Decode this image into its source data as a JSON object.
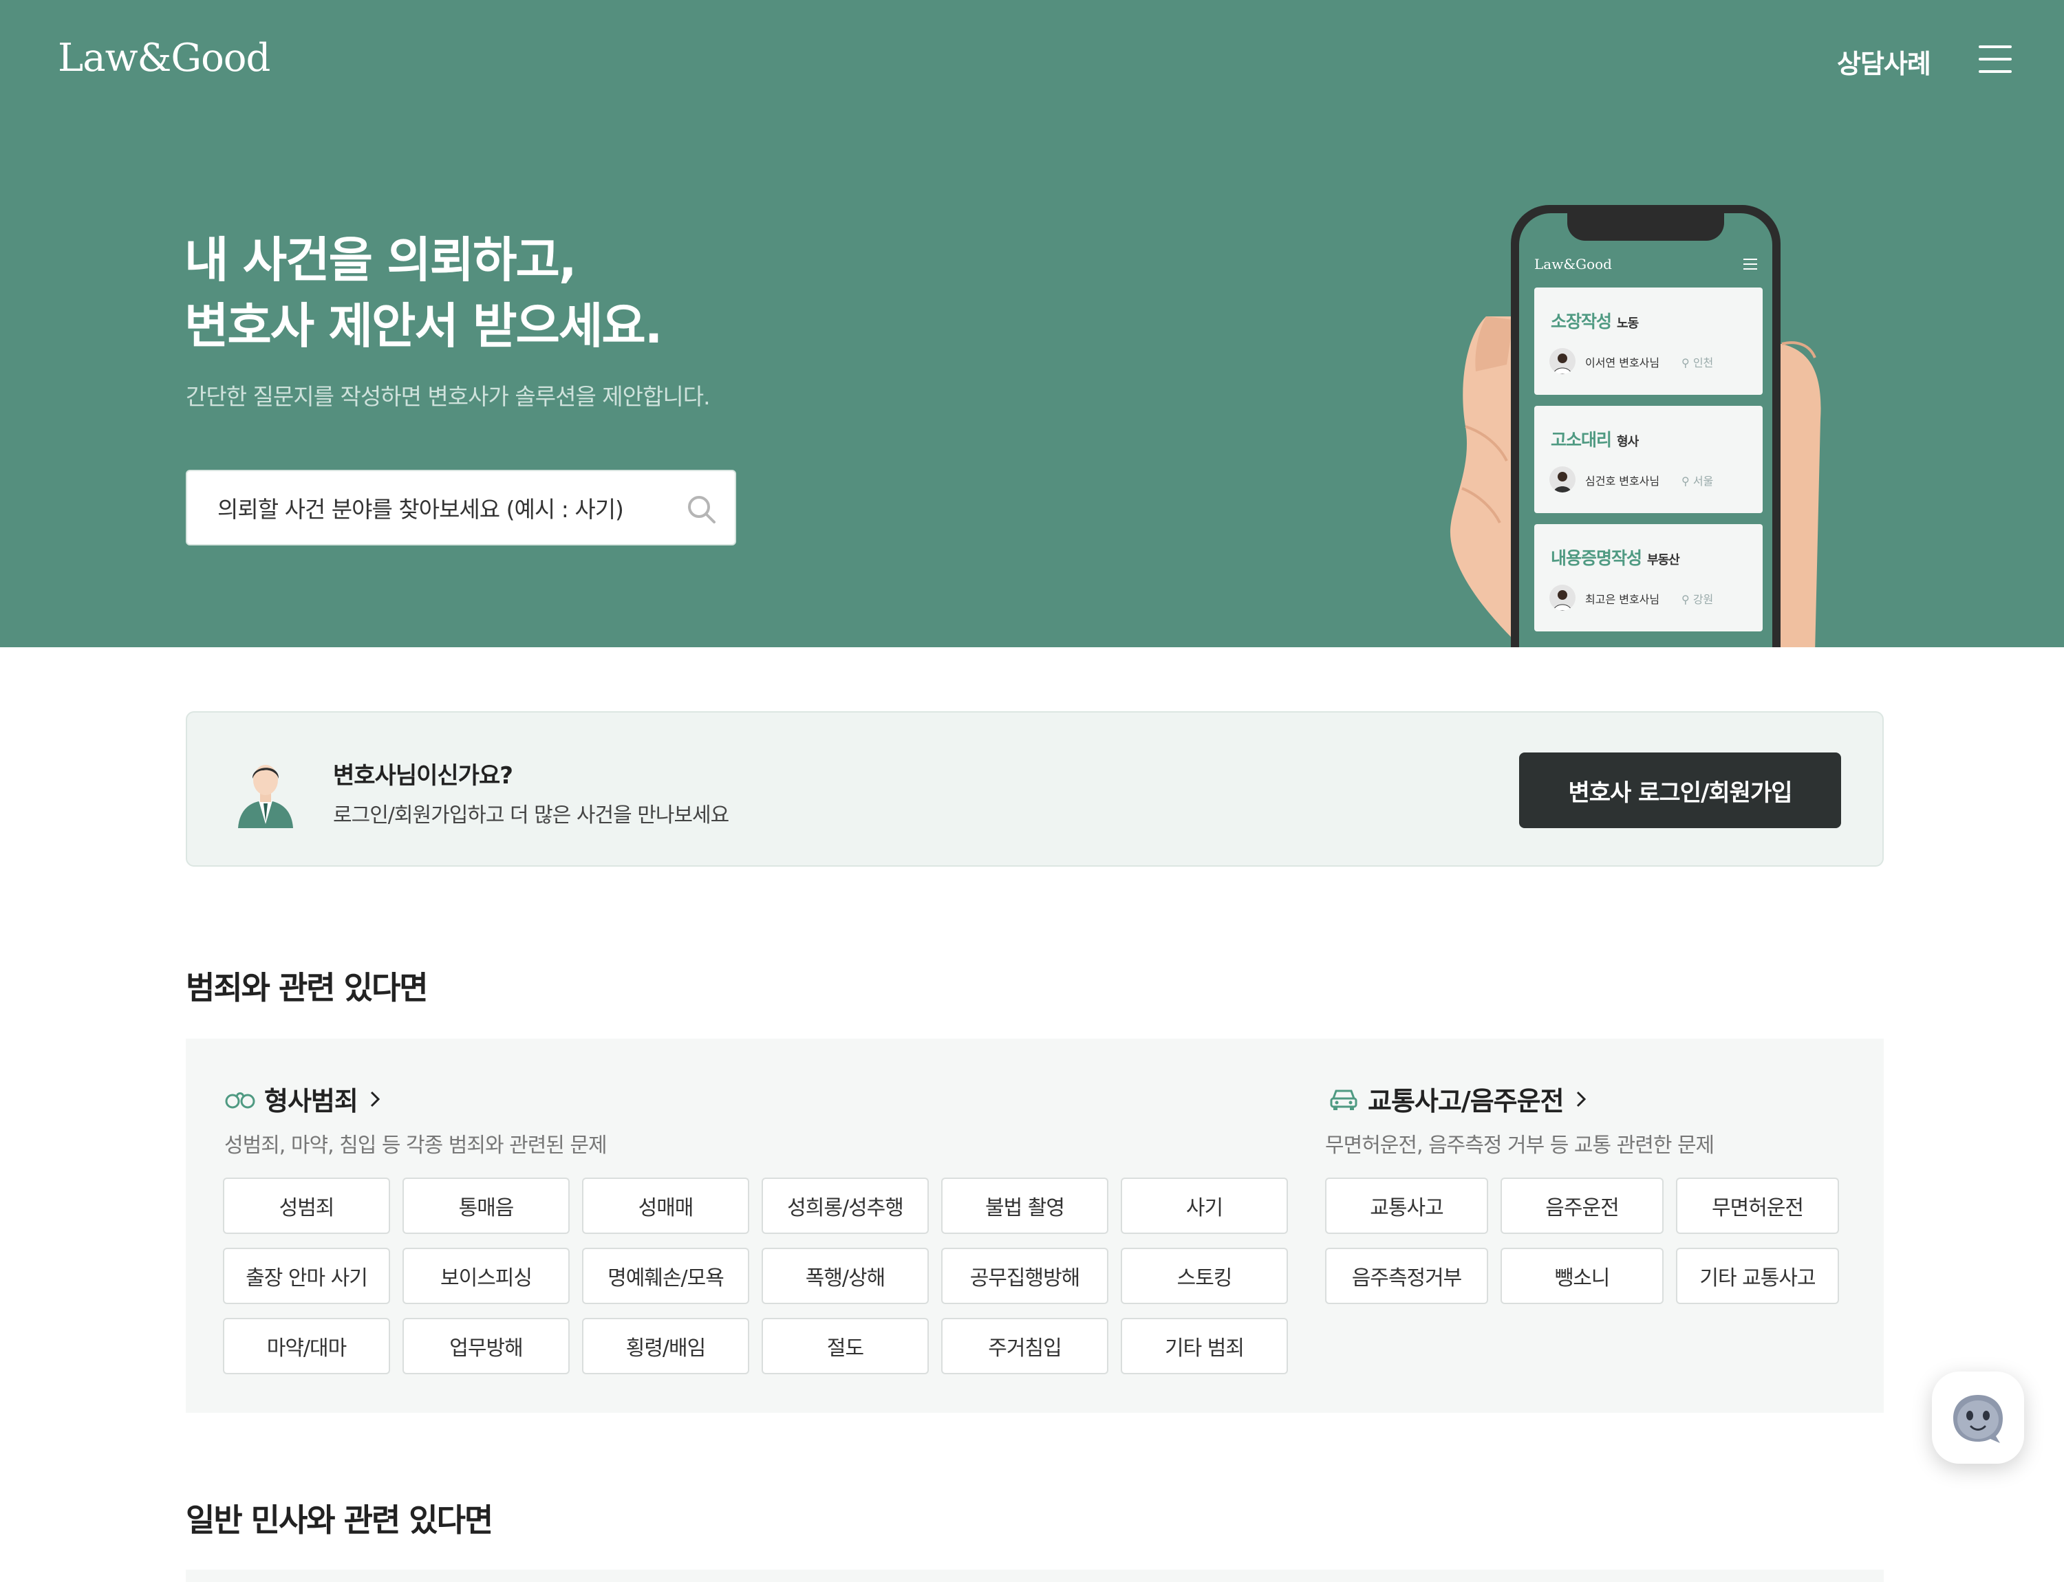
{
  "header": {
    "logo": "Law&Good",
    "nav_cases": "상담사례",
    "menu_icon": "hamburger-menu-icon"
  },
  "hero": {
    "title_line1": "내 사건을 의뢰하고,",
    "title_line2": "변호사 제안서 받으세요.",
    "subtitle": "간단한 질문지를 작성하면 변호사가 솔루션을 제안합니다.",
    "search": {
      "placeholder": "의뢰할 사건 분야를 찾아보세요 (예시 : 사기)",
      "icon": "search-icon"
    },
    "phone": {
      "logo": "Law&Good",
      "cards": [
        {
          "title": "소장작성",
          "tag": "노동",
          "lawyer": "이서연 변호사님",
          "location": "인천"
        },
        {
          "title": "고소대리",
          "tag": "형사",
          "lawyer": "심건호 변호사님",
          "location": "서울"
        },
        {
          "title": "내용증명작성",
          "tag": "부동산",
          "lawyer": "최고은 변호사님",
          "location": "강원"
        }
      ]
    }
  },
  "lawyer_banner": {
    "question": "변호사님이신가요?",
    "description": "로그인/회원가입하고 더 많은 사건을 만나보세요",
    "button": "변호사 로그인/회원가입"
  },
  "sections": {
    "crime": {
      "heading": "범죄와 관련 있다면",
      "categories": [
        {
          "title": "형사범죄",
          "icon": "handcuffs-icon",
          "description": "성범죄, 마약, 침입 등 각종 범죄와 관련된 문제",
          "tags": [
            "성범죄",
            "통매음",
            "성매매",
            "성희롱/성추행",
            "불법 촬영",
            "사기",
            "출장 안마 사기",
            "보이스피싱",
            "명예훼손/모욕",
            "폭행/상해",
            "공무집행방해",
            "스토킹",
            "마약/대마",
            "업무방해",
            "횡령/배임",
            "절도",
            "주거침입",
            "기타 범죄"
          ]
        },
        {
          "title": "교통사고/음주운전",
          "icon": "car-icon",
          "description": "무면허운전, 음주측정 거부 등 교통 관련한 문제",
          "tags": [
            "교통사고",
            "음주운전",
            "무면허운전",
            "음주측정거부",
            "뺑소니",
            "기타 교통사고"
          ]
        }
      ]
    },
    "civil": {
      "heading": "일반 민사와 관련 있다면"
    }
  },
  "chat": {
    "icon": "chatbot-icon"
  },
  "colors": {
    "brand_green": "#558f7e",
    "accent_green": "#4f9a82",
    "dark_button": "#2d3232"
  }
}
